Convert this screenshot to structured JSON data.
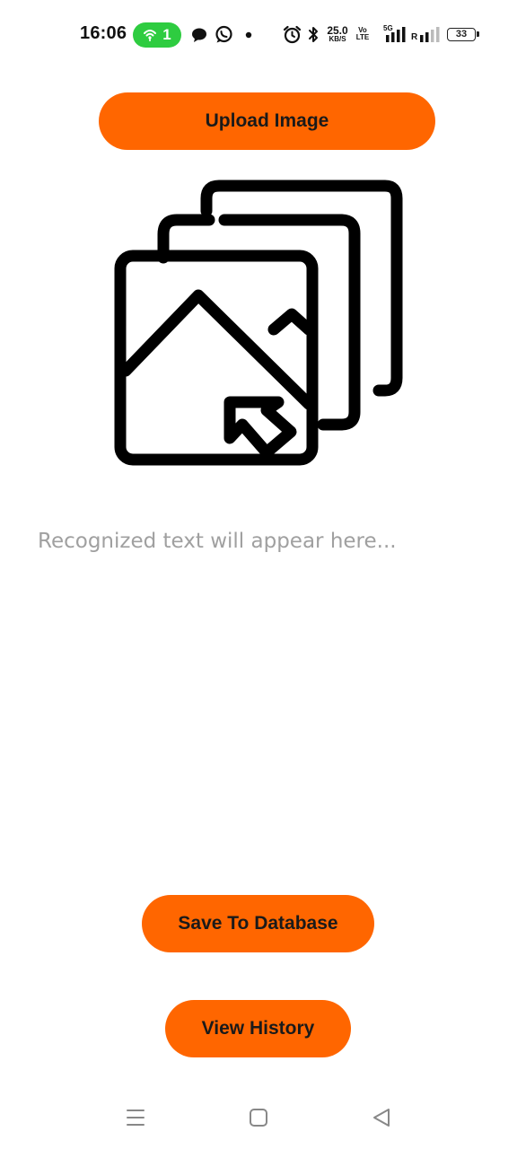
{
  "status_bar": {
    "time": "16:06",
    "hotspot_count": "1",
    "network_speed": "25.0",
    "network_speed_unit": "KB/S",
    "volte_top": "Vo",
    "volte_bottom": "LTE",
    "network_type": "5G",
    "roaming": "R",
    "battery_level": "33",
    "icons": [
      "hotspot-icon",
      "chat-bubble-icon",
      "whatsapp-icon",
      "notification-dot-icon",
      "alarm-icon",
      "bluetooth-icon",
      "signal-icon",
      "signal-weak-icon",
      "battery-icon"
    ]
  },
  "main": {
    "upload_button_label": "Upload Image",
    "illustration_icon": "image-upload-icon",
    "recognized_text_placeholder": "Recognized text will appear here...",
    "save_button_label": "Save To Database",
    "history_button_label": "View History"
  },
  "navigation_bar": {
    "icons": [
      "menu-icon",
      "home-icon",
      "back-icon"
    ]
  },
  "colors": {
    "accent": "#ff6600",
    "placeholder_text": "#a0a0a0",
    "hotspot_green": "#2ecc40",
    "background": "#ffffff"
  }
}
